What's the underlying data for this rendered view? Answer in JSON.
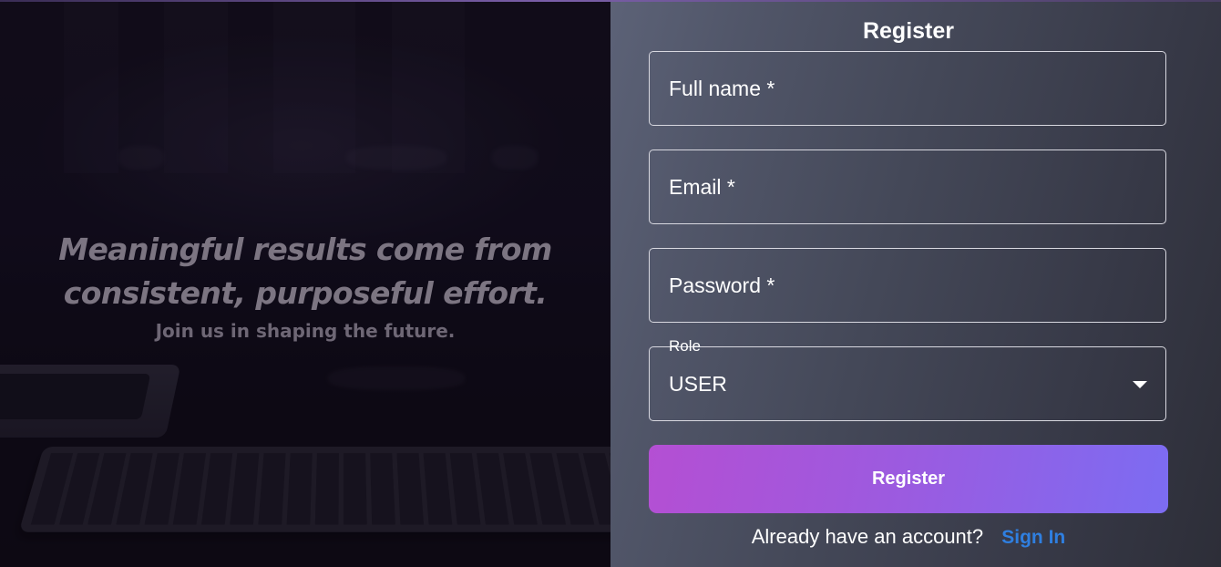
{
  "hero": {
    "headline_line1": "Meaningful results come from",
    "headline_line2": "consistent, purposeful effort.",
    "subtitle": "Join us in shaping the future."
  },
  "form": {
    "title": "Register",
    "fields": {
      "full_name": {
        "placeholder": "Full name *"
      },
      "email": {
        "placeholder": "Email *"
      },
      "password": {
        "placeholder": "Password *"
      },
      "role": {
        "label": "Role",
        "value": "USER"
      }
    },
    "submit_label": "Register",
    "signin_prompt": "Already have an account?",
    "signin_link": "Sign In"
  },
  "colors": {
    "button_gradient_start": "#b44fd3",
    "button_gradient_end": "#7c6cf2",
    "link": "#2f7fe0",
    "field_border": "#d8d8e0"
  },
  "icons": {
    "role_dropdown": "chevron-down-icon"
  }
}
